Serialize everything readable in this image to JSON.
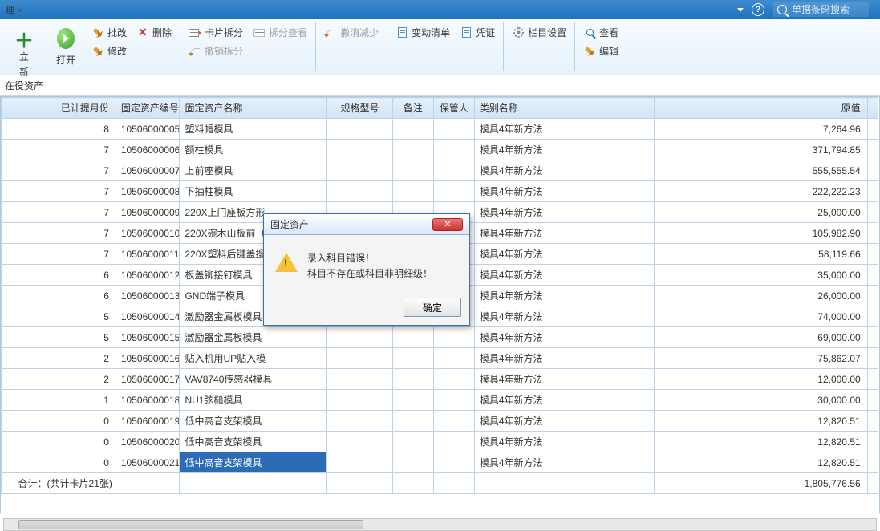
{
  "titlebar": {
    "tab_suffix": "理",
    "search_placeholder": "单据条码搜索"
  },
  "ribbon": {
    "group1": {
      "big1_suffix": "立",
      "big2": "打开",
      "small_new_suffix": "新",
      "small_batch": "批改",
      "small_modify": "修改",
      "small_delete": "删除"
    },
    "group2": {
      "card_split": "卡片拆分",
      "undo_split": "撤销拆分",
      "split_view": "拆分查看"
    },
    "group3": {
      "undo_reduce": "撤消减少"
    },
    "group4": {
      "change_list": "变动清单",
      "voucher": "凭证"
    },
    "group5": {
      "column_set": "栏目设置"
    },
    "group6": {
      "view": "查看",
      "edit": "编辑"
    }
  },
  "breadcrumb": "在役资产",
  "columns": {
    "months": "已计提月份",
    "code": "固定资产编号",
    "name": "固定资产名称",
    "spec": "规格型号",
    "remark": "备注",
    "keeper": "保管人",
    "category": "类别名称",
    "value": "原值"
  },
  "rows": [
    {
      "m": "8",
      "code": "10506000005",
      "name": "塑料帽模具",
      "cat": "模具4年新方法",
      "val": "7,264.96"
    },
    {
      "m": "7",
      "code": "10506000006",
      "name": "额柱模具",
      "cat": "模具4年新方法",
      "val": "371,794.85"
    },
    {
      "m": "7",
      "code": "10506000007",
      "name": "上前座模具",
      "cat": "模具4年新方法",
      "val": "555,555.54"
    },
    {
      "m": "7",
      "code": "10506000008",
      "name": "下抽柱模具",
      "cat": "模具4年新方法",
      "val": "222,222.23"
    },
    {
      "m": "7",
      "code": "10506000009",
      "name": "220X上门座板方形",
      "cat": "模具4年新方法",
      "val": "25,000.00"
    },
    {
      "m": "7",
      "code": "10506000010",
      "name": "220X碗木山板前（",
      "cat": "模具4年新方法",
      "val": "105,982.90"
    },
    {
      "m": "7",
      "code": "10506000011",
      "name": "220X塑料后键盖搜",
      "cat": "模具4年新方法",
      "val": "58,119.66"
    },
    {
      "m": "6",
      "code": "10506000012",
      "name": "板盖铆接钉模具",
      "cat": "模具4年新方法",
      "val": "35,000.00"
    },
    {
      "m": "6",
      "code": "10506000013",
      "name": "GND端子模具",
      "cat": "模具4年新方法",
      "val": "26,000.00"
    },
    {
      "m": "5",
      "code": "10506000014",
      "name": "激励器金属板模具",
      "cat": "模具4年新方法",
      "val": "74,000.00"
    },
    {
      "m": "5",
      "code": "10506000015",
      "name": "激励器金属板模具",
      "cat": "模具4年新方法",
      "val": "69,000.00"
    },
    {
      "m": "2",
      "code": "10506000016",
      "name": "贴入机用UP贴入模",
      "cat": "模具4年新方法",
      "val": "75,862.07"
    },
    {
      "m": "2",
      "code": "10506000017",
      "name": "VAV8740传感器模具",
      "cat": "模具4年新方法",
      "val": "12,000.00"
    },
    {
      "m": "1",
      "code": "10506000018",
      "name": "NU1弦槌模具",
      "cat": "模具4年新方法",
      "val": "30,000.00"
    },
    {
      "m": "0",
      "code": "10506000019",
      "name": "低中高音支架模具",
      "cat": "模具4年新方法",
      "val": "12,820.51"
    },
    {
      "m": "0",
      "code": "10506000020",
      "name": "低中高音支架模具",
      "cat": "模具4年新方法",
      "val": "12,820.51"
    },
    {
      "m": "0",
      "code": "10506000021",
      "name": "低中高音支架模具",
      "cat": "模具4年新方法",
      "val": "12,820.51",
      "selected": true
    }
  ],
  "totals": {
    "label": "合计：(共计卡片21张)",
    "value": "1,805,776.56"
  },
  "modal": {
    "title": "固定资产",
    "line1": "录入科目错误！",
    "line2": "科目不存在或科目非明细级！",
    "ok": "确定"
  }
}
